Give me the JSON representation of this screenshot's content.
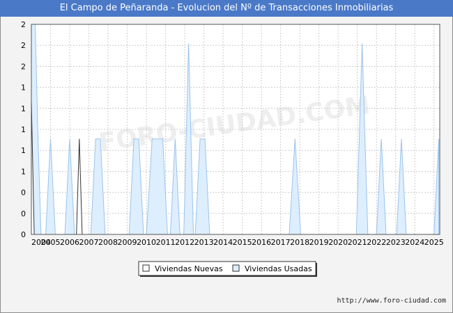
{
  "title": "El Campo de Peñaranda - Evolucion del Nº de Transacciones Inmobiliarias",
  "watermark": "FORO-CIUDAD.COM",
  "footer_url": "http://www.foro-ciudad.com",
  "chart_data": {
    "type": "area",
    "x_tick_labels": [
      "2004",
      "2005",
      "2006",
      "2007",
      "2008",
      "2009",
      "2010",
      "2011",
      "2012",
      "2013",
      "2014",
      "2015",
      "2016",
      "2017",
      "2018",
      "2019",
      "2020",
      "2021",
      "2022",
      "2023",
      "2024",
      "2025"
    ],
    "y_tick_labels": [
      "0",
      "0",
      "0",
      "1",
      "1",
      "1",
      "1",
      "1",
      "2",
      "2",
      "2"
    ],
    "ylim": [
      0,
      2.2
    ],
    "grid": true,
    "legend_position": "bottom-center",
    "series": [
      {
        "name": "Viviendas Nuevas",
        "color": "#ffffff",
        "stroke": "#333333",
        "points": [
          [
            2004.0,
            1.4
          ],
          [
            2004.15,
            0
          ],
          [
            2006.35,
            0
          ],
          [
            2006.5,
            1
          ],
          [
            2006.65,
            0
          ],
          [
            2025.3,
            0
          ]
        ]
      },
      {
        "name": "Viviendas Usadas",
        "color": "#ddeeff",
        "stroke": "#9cc3ea",
        "points": [
          [
            2004.0,
            2.2
          ],
          [
            2004.2,
            2.2
          ],
          [
            2004.35,
            1
          ],
          [
            2004.5,
            0
          ],
          [
            2004.75,
            0
          ],
          [
            2005.0,
            1
          ],
          [
            2005.25,
            0
          ],
          [
            2005.75,
            0
          ],
          [
            2006.0,
            1
          ],
          [
            2006.25,
            0
          ],
          [
            2007.1,
            0
          ],
          [
            2007.35,
            1
          ],
          [
            2007.6,
            1
          ],
          [
            2007.85,
            0
          ],
          [
            2009.1,
            0
          ],
          [
            2009.35,
            1
          ],
          [
            2009.6,
            1
          ],
          [
            2009.85,
            0
          ],
          [
            2010.0,
            0
          ],
          [
            2010.3,
            1
          ],
          [
            2010.85,
            1
          ],
          [
            2011.1,
            0
          ],
          [
            2011.25,
            0
          ],
          [
            2011.5,
            1
          ],
          [
            2011.75,
            0
          ],
          [
            2011.95,
            0
          ],
          [
            2012.2,
            2
          ],
          [
            2012.45,
            0
          ],
          [
            2012.55,
            0
          ],
          [
            2012.8,
            1
          ],
          [
            2013.05,
            1
          ],
          [
            2013.3,
            0
          ],
          [
            2017.45,
            0
          ],
          [
            2017.75,
            1
          ],
          [
            2018.05,
            0
          ],
          [
            2020.95,
            0
          ],
          [
            2021.25,
            2
          ],
          [
            2021.55,
            0
          ],
          [
            2022.0,
            0
          ],
          [
            2022.25,
            1
          ],
          [
            2022.5,
            0
          ],
          [
            2023.05,
            0
          ],
          [
            2023.3,
            1
          ],
          [
            2023.55,
            0
          ],
          [
            2025.0,
            0
          ],
          [
            2025.25,
            1
          ]
        ]
      }
    ]
  }
}
